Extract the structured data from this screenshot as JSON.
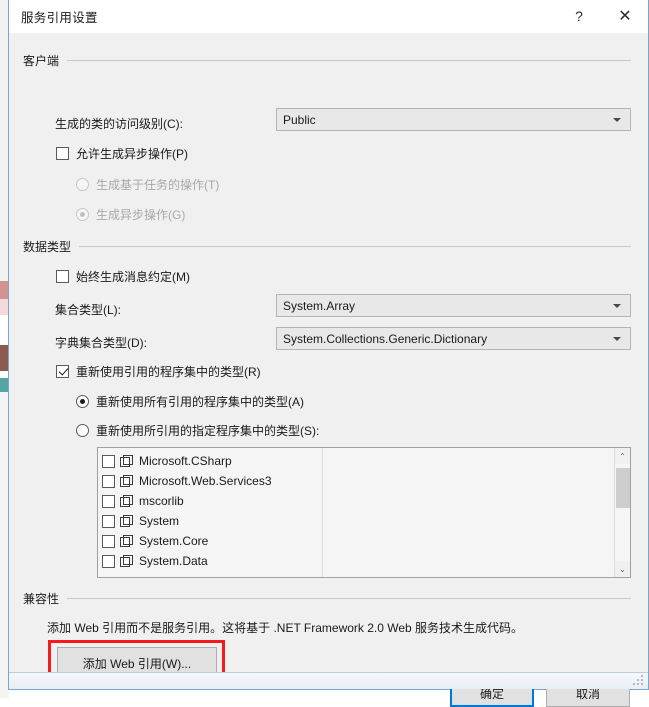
{
  "window": {
    "title": "服务引用设置",
    "help_icon": "?",
    "close_icon": "✕"
  },
  "client_group": {
    "legend": "客户端",
    "access_level_label": "生成的类的访问级别(C):",
    "access_level_value": "Public",
    "allow_async_label": "允许生成异步操作(P)",
    "allow_async_checked": false,
    "task_based_label": "生成基于任务的操作(T)",
    "async_op_label": "生成异步操作(G)"
  },
  "data_type_group": {
    "legend": "数据类型",
    "always_msg_contracts_label": "始终生成消息约定(M)",
    "collection_type_label": "集合类型(L):",
    "collection_type_value": "System.Array",
    "dictionary_type_label": "字典集合类型(D):",
    "dictionary_type_value": "System.Collections.Generic.Dictionary",
    "reuse_types_label": "重新使用引用的程序集中的类型(R)",
    "reuse_all_label": "重新使用所有引用的程序集中的类型(A)",
    "reuse_specified_label": "重新使用所引用的指定程序集中的类型(S):",
    "assemblies": [
      {
        "name": "Microsoft.CSharp",
        "checked": false,
        "icon": "assembly-icon"
      },
      {
        "name": "Microsoft.Web.Services3",
        "checked": false,
        "icon": "assembly-icon"
      },
      {
        "name": "mscorlib",
        "checked": false,
        "icon": "assembly-icon"
      },
      {
        "name": "System",
        "checked": false,
        "icon": "assembly-icon"
      },
      {
        "name": "System.Core",
        "checked": false,
        "icon": "assembly-icon"
      },
      {
        "name": "System.Data",
        "checked": false,
        "icon": "assembly-icon"
      }
    ],
    "scroll_up_icon": "⌃",
    "scroll_down_icon": "⌄"
  },
  "compat_group": {
    "legend": "兼容性",
    "description": "添加 Web 引用而不是服务引用。这将基于 .NET Framework 2.0 Web 服务技术生成代码。",
    "add_web_ref_label": "添加 Web 引用(W)..."
  },
  "footer": {
    "ok_label": "确定",
    "cancel_label": "取消"
  },
  "colors": {
    "dialog_bg": "#f0f0f0",
    "highlight_red": "#f51b1b",
    "focus_blue": "#0078d7",
    "titlebar_bg": "#ffffff"
  }
}
